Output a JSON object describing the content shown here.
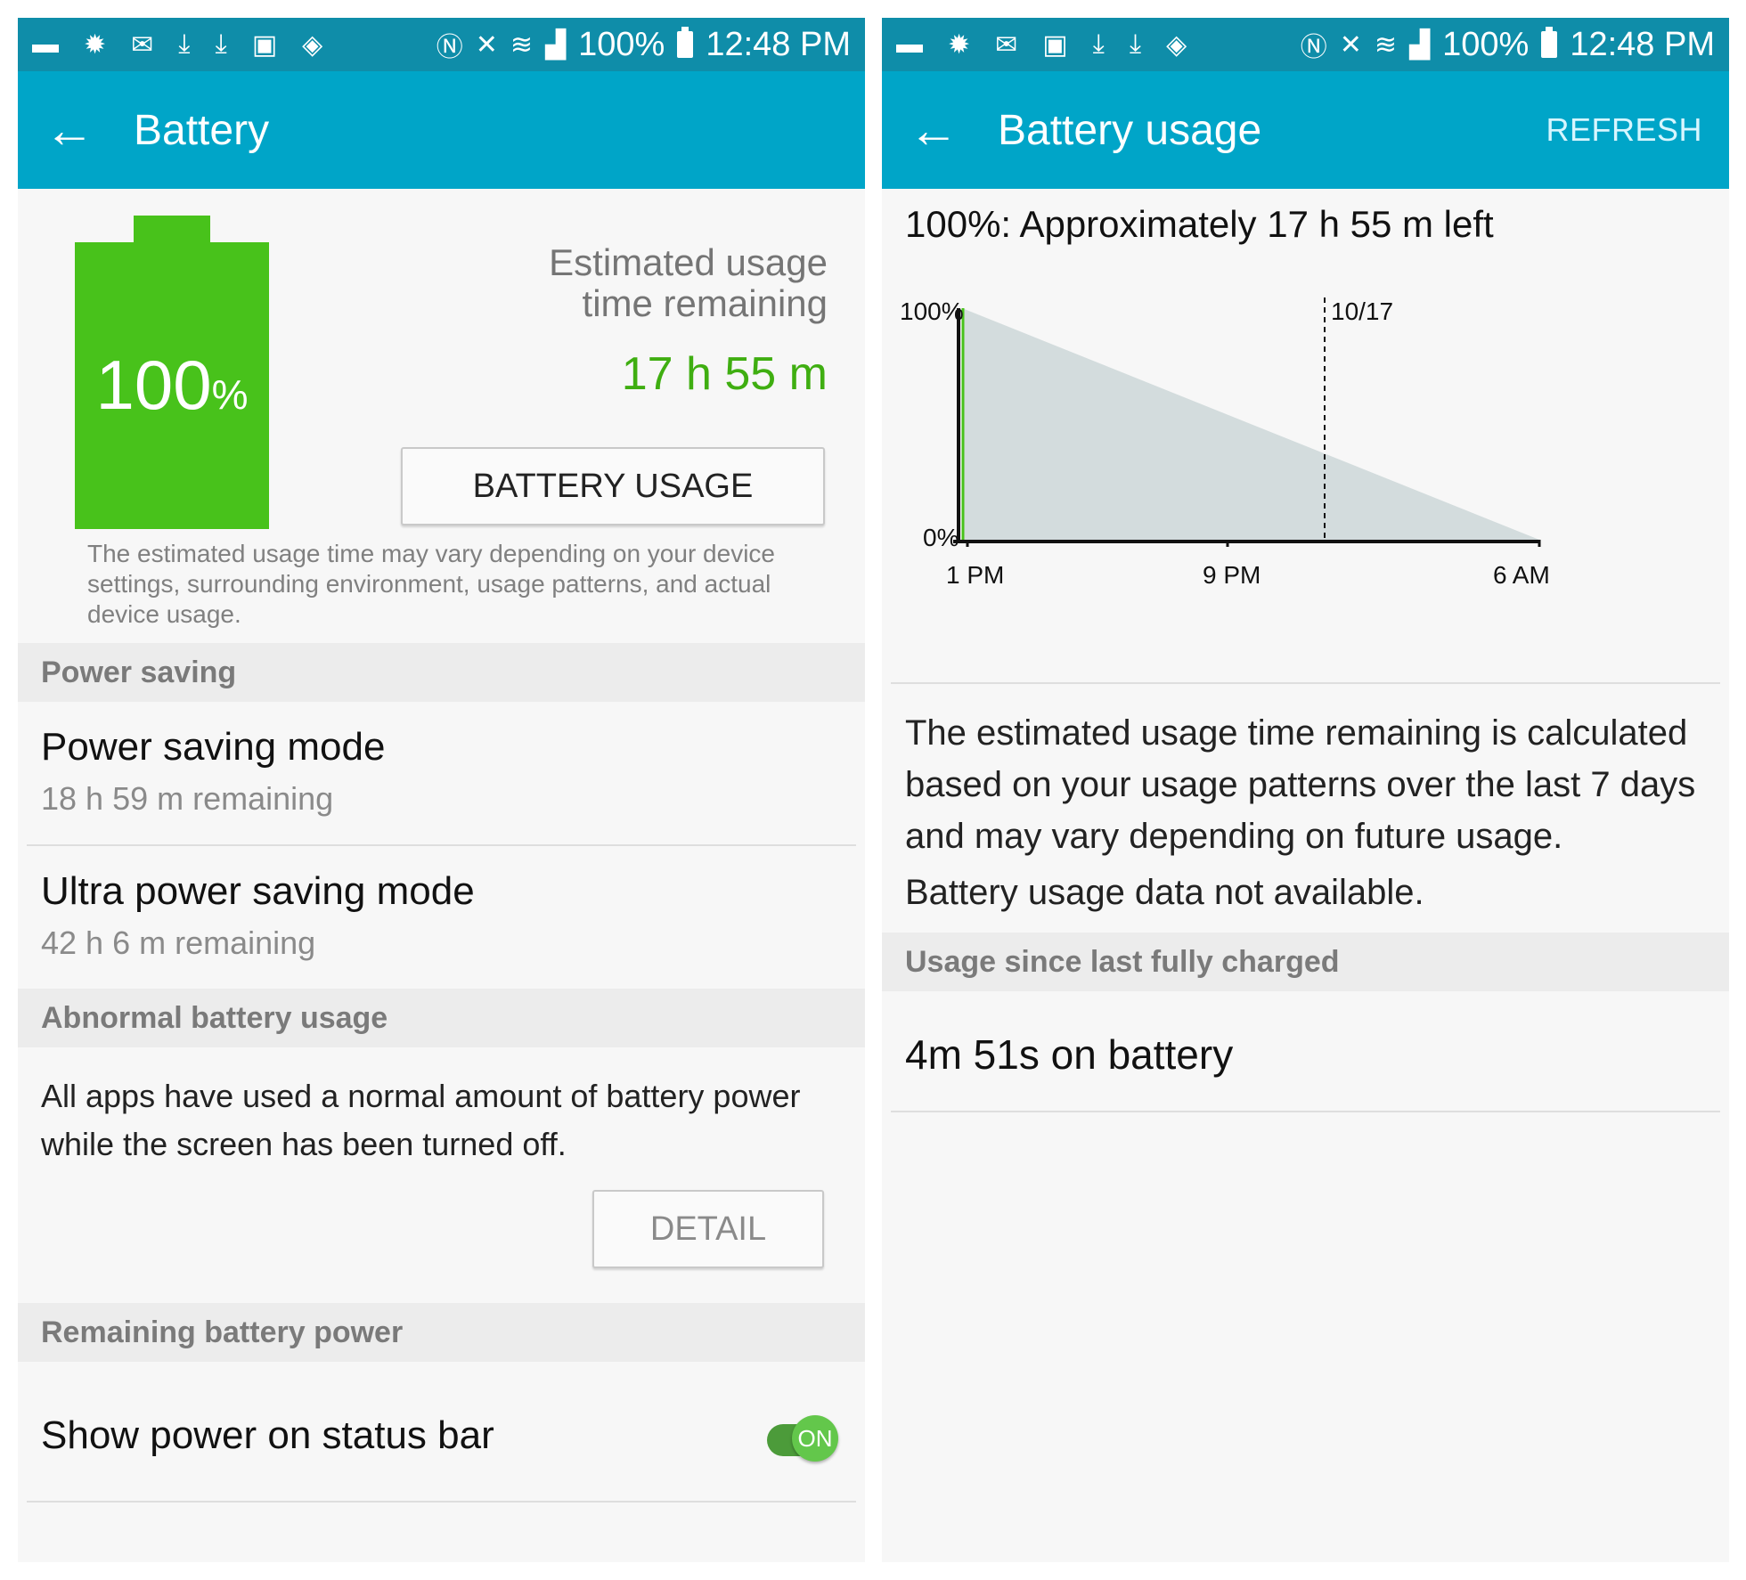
{
  "status_bar": {
    "battery": "100%",
    "time": "12:48 PM"
  },
  "left": {
    "appbar": {
      "title": "Battery"
    },
    "battery_level": "100",
    "battery_level_unit": "%",
    "estimated_label": "Estimated usage time remaining",
    "estimated_time": "17 h 55 m",
    "battery_usage_button": "BATTERY USAGE",
    "disclaimer": "The estimated usage time may vary depending on your device settings, surrounding environment, usage patterns, and actual device usage.",
    "sections": {
      "power_saving": "Power saving",
      "abnormal": "Abnormal battery usage",
      "remaining": "Remaining battery power"
    },
    "power_saving_mode": {
      "title": "Power saving mode",
      "subtitle": "18 h 59 m remaining"
    },
    "ultra_power_saving_mode": {
      "title": "Ultra power saving mode",
      "subtitle": "42 h 6 m remaining"
    },
    "abnormal_text": "All apps have used a normal amount of battery power while the screen has been turned off.",
    "detail_button": "DETAIL",
    "show_power": {
      "label": "Show power on status bar",
      "state": "ON"
    }
  },
  "right": {
    "appbar": {
      "title": "Battery usage",
      "action": "REFRESH"
    },
    "chart_title": "100%: Approximately 17 h 55 m left",
    "chart_data": {
      "type": "area",
      "y_labels": [
        "100%",
        "0%"
      ],
      "x_tick_labels": [
        "1 PM",
        "9 PM",
        "6 AM"
      ],
      "marker_label": "10/17",
      "ylim": [
        0,
        100
      ],
      "series": [
        {
          "x": [
            "12:48 PM",
            "6:43 AM"
          ],
          "values": [
            100,
            0
          ]
        }
      ],
      "colors": {
        "fill": "#d3dcdd",
        "now_line": "#48c21b",
        "axis": "#111111"
      }
    },
    "explanation": "The estimated usage time remaining is calculated based on your usage patterns over the last 7 days and may vary depending on future usage.",
    "not_available": "Battery usage data not available.",
    "section_usage_since": "Usage since last fully charged",
    "on_battery": "4m 51s on battery"
  },
  "colors": {
    "status_bar": "#0f8da9",
    "app_bar": "#00a5c8",
    "battery_green": "#48c21b",
    "accent_green": "#3fae11"
  },
  "icons": [
    "chat-icon",
    "brightness-icon",
    "mail-icon",
    "download-icon",
    "image-icon",
    "vpn-icon",
    "nfc-icon",
    "mute-icon",
    "wifi-icon",
    "signal-icon",
    "battery-icon",
    "back-arrow-icon"
  ]
}
